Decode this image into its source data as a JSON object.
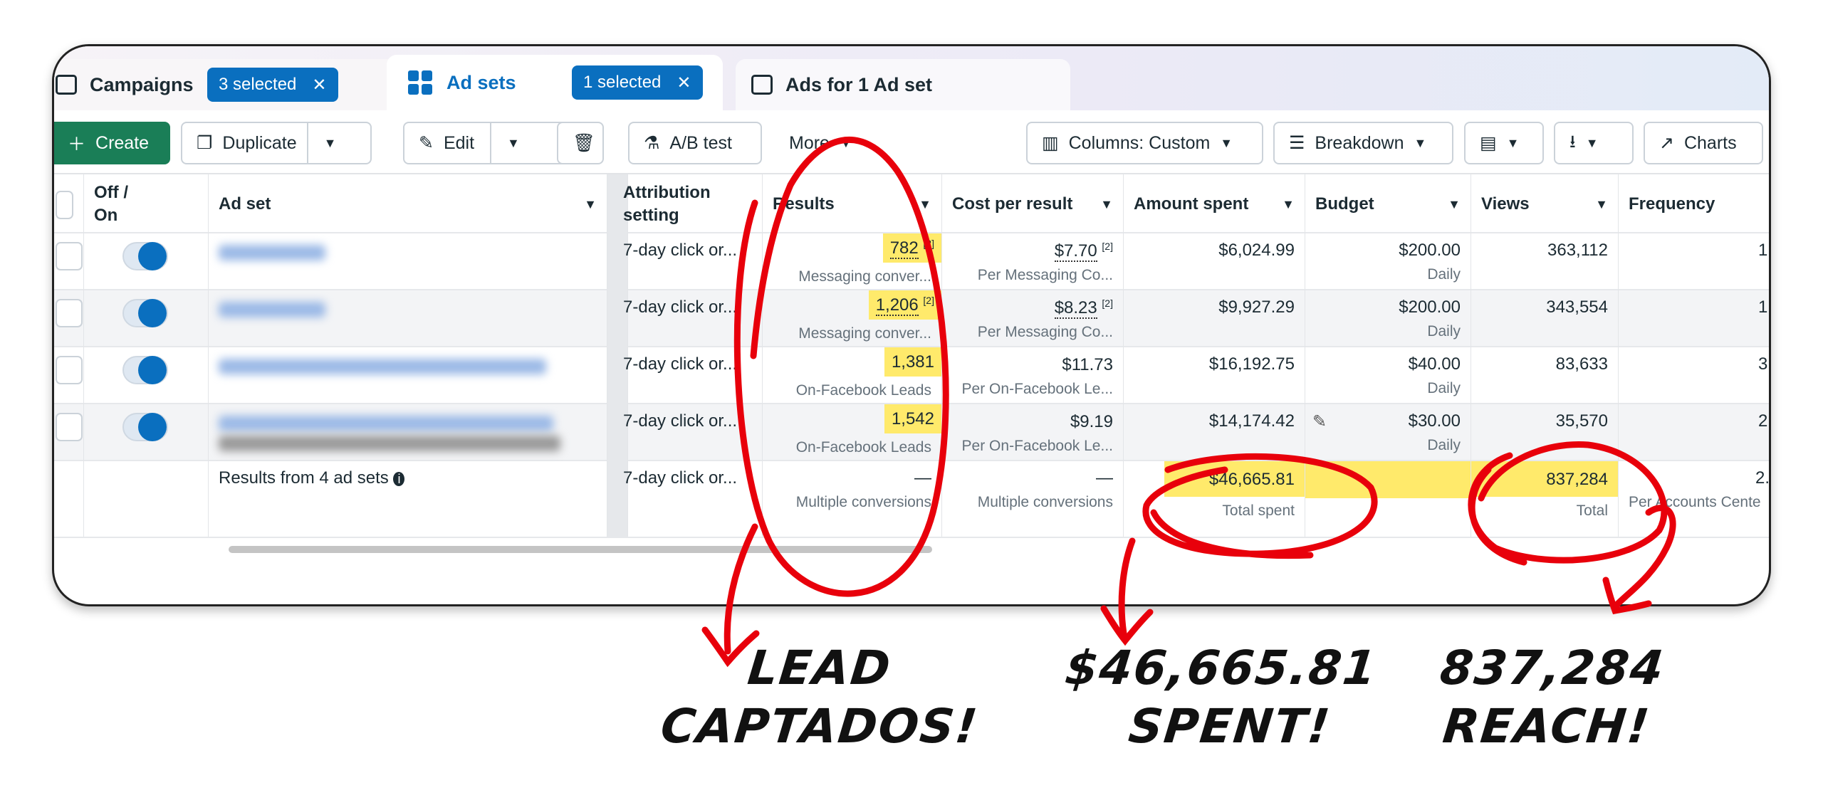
{
  "tabs": [
    {
      "label": "Campaigns",
      "selected": "3 selected"
    },
    {
      "label": "Ad sets",
      "selected": "1 selected",
      "active": true
    },
    {
      "label": "Ads for 1 Ad set"
    }
  ],
  "toolbar": {
    "create": "Create",
    "duplicate": "Duplicate",
    "edit": "Edit",
    "ab_test": "A/B test",
    "more": "More",
    "columns": "Columns: Custom",
    "breakdown": "Breakdown",
    "charts": "Charts"
  },
  "columns": [
    "Off / On",
    "Ad set",
    "Attribution setting",
    "Results",
    "Cost per result",
    "Amount spent",
    "Budget",
    "Views",
    "Frequency"
  ],
  "rows": [
    {
      "attribution": "7-day click or...",
      "results": "782",
      "results_note": "[2]",
      "results_sub": "Messaging conver...",
      "cpr": "$7.70",
      "cpr_note": "[2]",
      "cpr_sub": "Per Messaging Co...",
      "amount": "$6,024.99",
      "budget": "$200.00",
      "budget_sub": "Daily",
      "views": "363,112",
      "frequency": "1."
    },
    {
      "attribution": "7-day click or...",
      "results": "1,206",
      "results_note": "[2]",
      "results_sub": "Messaging conver...",
      "cpr": "$8.23",
      "cpr_note": "[2]",
      "cpr_sub": "Per Messaging Co...",
      "amount": "$9,927.29",
      "budget": "$200.00",
      "budget_sub": "Daily",
      "views": "343,554",
      "frequency": "1."
    },
    {
      "attribution": "7-day click or...",
      "results": "1,381",
      "results_note": "",
      "results_sub": "On-Facebook Leads",
      "cpr": "$11.73",
      "cpr_note": "",
      "cpr_sub": "Per On-Facebook Le...",
      "amount": "$16,192.75",
      "budget": "$40.00",
      "budget_sub": "Daily",
      "views": "83,633",
      "frequency": "3."
    },
    {
      "attribution": "7-day click or...",
      "results": "1,542",
      "results_note": "",
      "results_sub": "On-Facebook Leads",
      "cpr": "$9.19",
      "cpr_note": "",
      "cpr_sub": "Per On-Facebook Le...",
      "amount": "$14,174.42",
      "budget": "$30.00",
      "budget_sub": "Daily",
      "views": "35,570",
      "frequency": "2."
    }
  ],
  "summary": {
    "label": "Results from 4 ad sets",
    "attribution": "7-day click or...",
    "results": "—",
    "results_sub": "Multiple conversions",
    "cpr": "—",
    "cpr_sub": "Multiple conversions",
    "amount": "$46,665.81",
    "amount_sub": "Total spent",
    "views": "837,284",
    "views_sub": "Total",
    "frequency": "2.",
    "frequency_sub": "Per Accounts Cente"
  },
  "annotations": {
    "leads": [
      "LEAD",
      "CAPTADOS!"
    ],
    "spent": [
      "$46,665.81",
      "SPENT!"
    ],
    "reach": [
      "837,284",
      "REACH!"
    ]
  },
  "colors": {
    "accent": "#0a6fbf",
    "create": "#1a7e57",
    "highlight": "#ffea6b",
    "annotation": "#e8000b"
  }
}
